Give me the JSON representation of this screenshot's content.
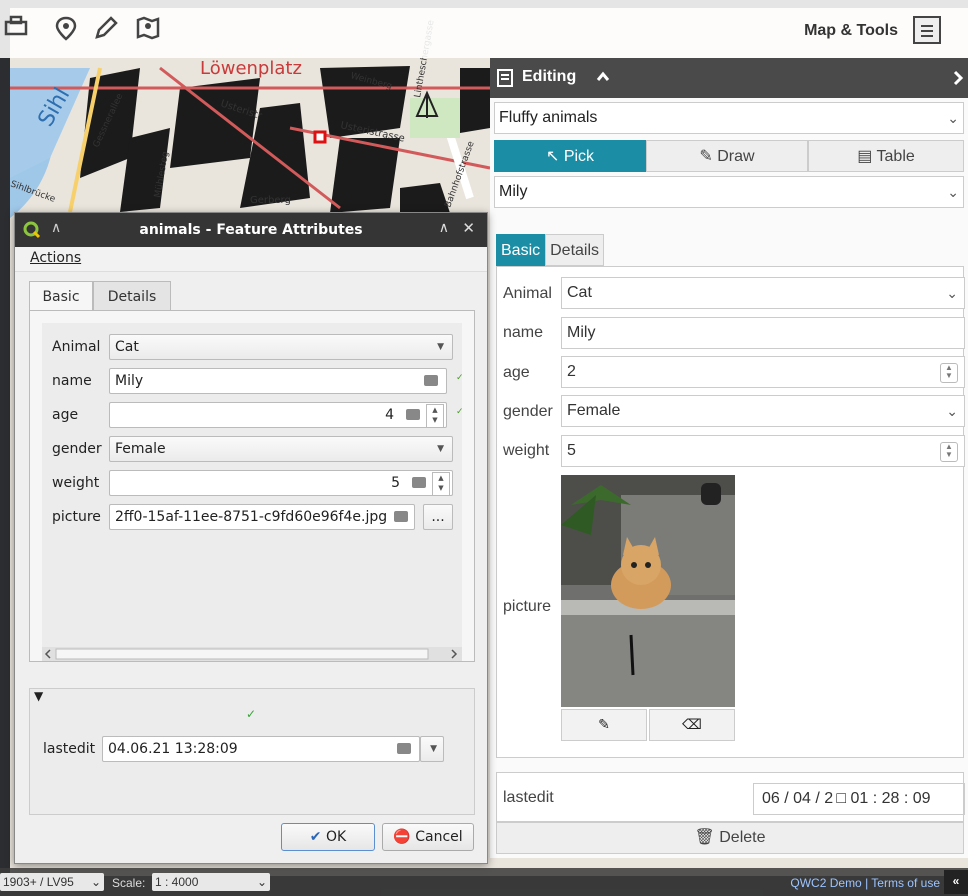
{
  "toolbar": {
    "title": "Map & Tools"
  },
  "map": {
    "labels": [
      "Löwenplatz",
      "Sihl",
      "Usteristr",
      "Usteristrasse",
      "Gessnerallee",
      "Gerberg",
      "Lintheschergasse",
      "Bahnhofstrasse",
      "Mühlesteg",
      "Weinberg",
      "Sihlbrücke"
    ]
  },
  "editing": {
    "title": "Editing",
    "layer": "Fluffy animals",
    "modes": {
      "pick": "Pick",
      "draw": "Draw",
      "table": "Table"
    },
    "feature": "Mily",
    "tabs": {
      "basic": "Basic",
      "details": "Details"
    },
    "fields": {
      "animal_label": "Animal",
      "animal_value": "Cat",
      "name_label": "name",
      "name_value": "Mily",
      "age_label": "age",
      "age_value": "2",
      "gender_label": "gender",
      "gender_value": "Female",
      "weight_label": "weight",
      "weight_value": "5",
      "picture_label": "picture"
    },
    "lastedit_label": "lastedit",
    "lastedit_value": "06 / 04 / 2 □   01 : 28 : 09",
    "delete_label": "Delete"
  },
  "dialog": {
    "title": "animals - Feature Attributes",
    "menu_actions": "Actions",
    "tabs": {
      "basic": "Basic",
      "details": "Details"
    },
    "fields": {
      "animal_label": "Animal",
      "animal_value": "Cat",
      "name_label": "name",
      "name_value": "Mily",
      "age_label": "age",
      "age_value": "4",
      "gender_label": "gender",
      "gender_value": "Female",
      "weight_label": "weight",
      "weight_value": "5",
      "picture_label": "picture",
      "picture_value": "2ff0-15af-11ee-8751-c9fd60e96f4e.jpg",
      "browse_label": "..."
    },
    "lastedit_label": "lastedit",
    "lastedit_value": "04.06.21 13:28:09",
    "ok_label": "OK",
    "cancel_label": "Cancel"
  },
  "statusbar": {
    "crs": "1903+ / LV95",
    "scale_label": "Scale:",
    "scale_value": "1 : 4000",
    "links": "QWC2 Demo | Terms of use",
    "collapse": "«"
  },
  "colors": {
    "accent": "#1b8ea6",
    "header": "#4a4a4a",
    "dialog_title": "#353535"
  }
}
